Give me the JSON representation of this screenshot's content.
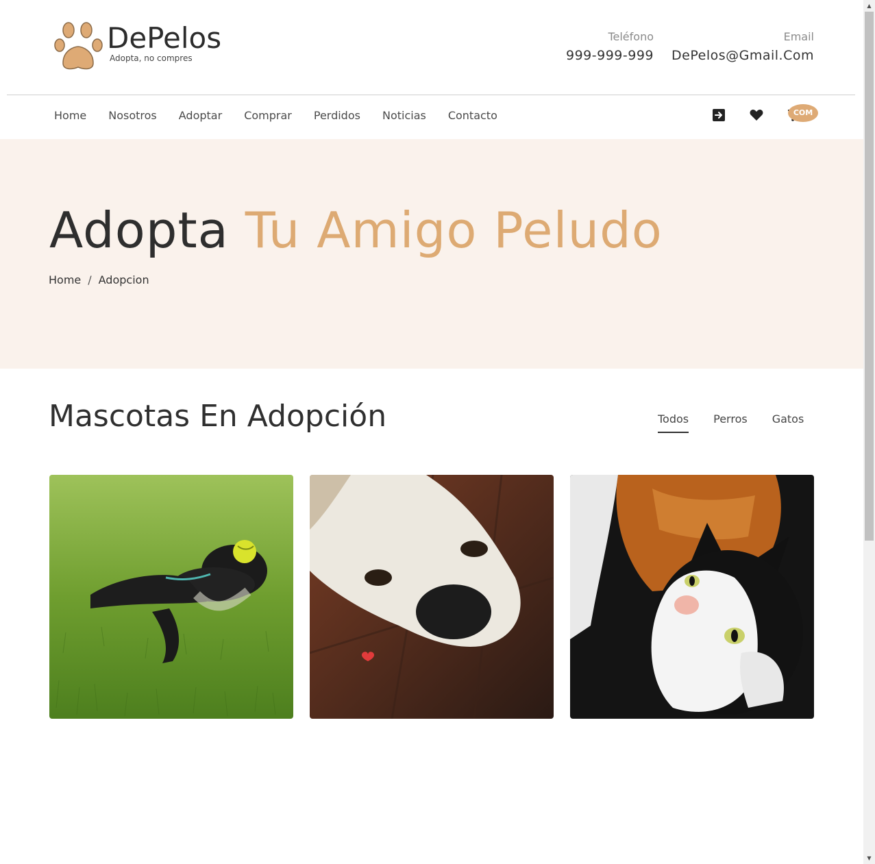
{
  "brand": {
    "name": "DePelos",
    "tagline": "Adopta, no compres",
    "accent_color": "#ddaa73",
    "hero_bg": "#faf2ec"
  },
  "contact": {
    "phone_label": "Teléfono",
    "phone_value": "999-999-999",
    "email_label": "Email",
    "email_value": "DePelos@Gmail.Com"
  },
  "nav": {
    "items": [
      {
        "label": "Home"
      },
      {
        "label": "Nosotros"
      },
      {
        "label": "Adoptar"
      },
      {
        "label": "Comprar"
      },
      {
        "label": "Perdidos"
      },
      {
        "label": "Noticias"
      },
      {
        "label": "Contacto"
      }
    ],
    "icons": [
      "login-icon",
      "heart-icon",
      "cart-icon"
    ],
    "cart_badge": "COM"
  },
  "hero": {
    "title_main": "Adopta",
    "title_accent": "Tu Amigo Peludo",
    "breadcrumb": {
      "home": "Home",
      "separator": "/",
      "current": "Adopcion"
    }
  },
  "section": {
    "title": "Mascotas En Adopción",
    "filters": [
      {
        "label": "Todos",
        "active": true
      },
      {
        "label": "Perros",
        "active": false
      },
      {
        "label": "Gatos",
        "active": false
      }
    ]
  },
  "pets": [
    {
      "image": "black-dog-on-grass-photo"
    },
    {
      "image": "white-dog-closeup-photo"
    },
    {
      "image": "black-white-cat-photo"
    }
  ]
}
